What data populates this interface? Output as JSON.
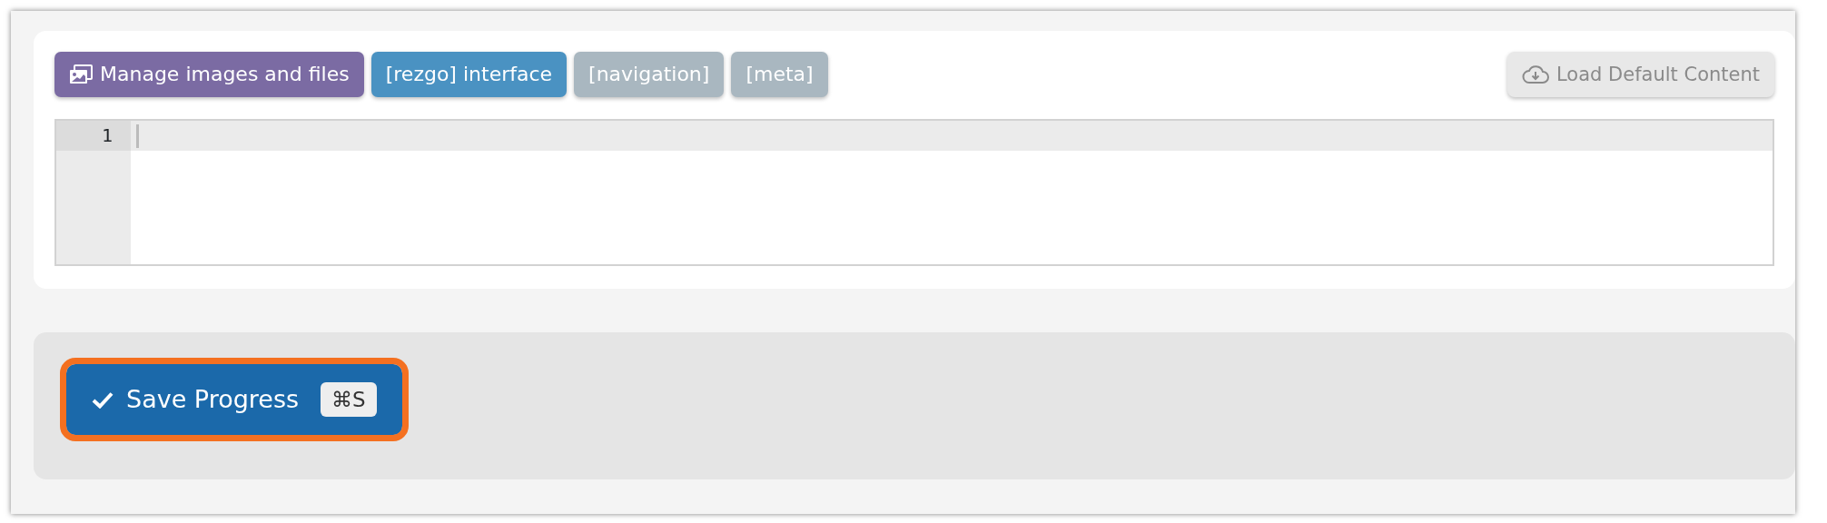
{
  "toolbar": [
    {
      "label": "Manage images and files",
      "kind": "media",
      "color": "#7b6ba3"
    },
    {
      "label": "[rezgo] interface",
      "kind": "tag",
      "color": "#4a92c2"
    },
    {
      "label": "[navigation]",
      "kind": "tag",
      "color": "#a9b7c0"
    },
    {
      "label": "[meta]",
      "kind": "tag",
      "color": "#a9b7c0"
    }
  ],
  "load_button": {
    "label": "Load Default Content"
  },
  "editor": {
    "line_numbers": [
      "1"
    ]
  },
  "save_button": {
    "label": "Save Progress",
    "shortcut": "⌘S",
    "highlighted": true
  }
}
